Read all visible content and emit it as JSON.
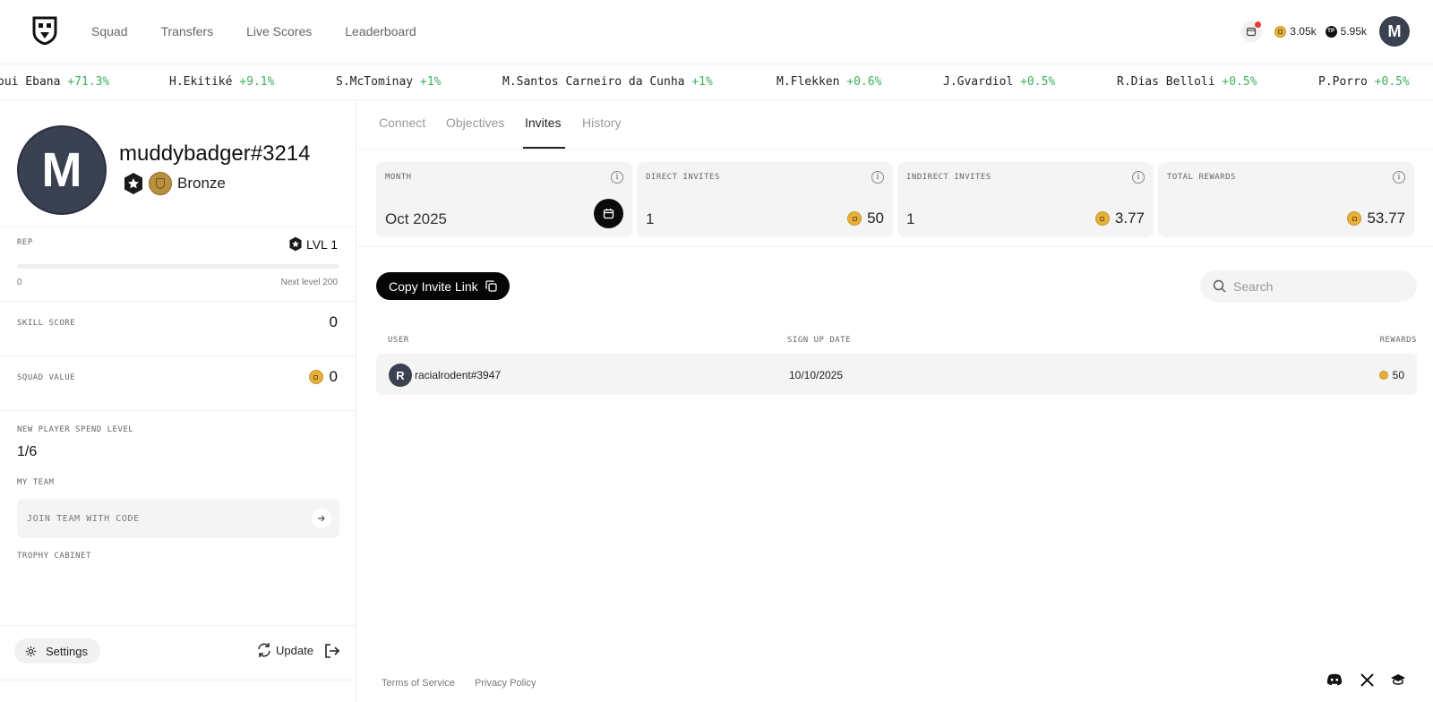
{
  "nav": [
    "Squad",
    "Transfers",
    "Live Scores",
    "Leaderboard"
  ],
  "header": {
    "coins": "3.05k",
    "points_badge": "TP",
    "points": "5.95k",
    "avatar_initial": "M"
  },
  "ticker": [
    {
      "name": "oui Ebana",
      "change": "+71.3%"
    },
    {
      "name": "H.Ekitiké",
      "change": "+9.1%"
    },
    {
      "name": "S.McTominay",
      "change": "+1%"
    },
    {
      "name": "M.Santos Carneiro da Cunha",
      "change": "+1%"
    },
    {
      "name": "M.Flekken",
      "change": "+0.6%"
    },
    {
      "name": "J.Gvardiol",
      "change": "+0.5%"
    },
    {
      "name": "R.Dias Belloli",
      "change": "+0.5%"
    },
    {
      "name": "P.Porro",
      "change": "+0.5%"
    }
  ],
  "profile": {
    "avatar_initial": "M",
    "username": "muddybadger#3214",
    "rank": "Bronze",
    "rep_label": "REP",
    "level": "LVL 1",
    "rep_progress": 0,
    "rep_min": "0",
    "rep_next": "Next level 200",
    "skill_label": "SKILL SCORE",
    "skill_value": "0",
    "squad_label": "SQUAD VALUE",
    "squad_value": "0",
    "spend_label": "NEW PLAYER SPEND LEVEL",
    "spend_value": "1/6",
    "team_label": "MY TEAM",
    "team_placeholder": "JOIN TEAM WITH CODE",
    "trophy_label": "TROPHY CABINET",
    "settings": "Settings",
    "update": "Update"
  },
  "tabs": [
    "Connect",
    "Objectives",
    "Invites",
    "History"
  ],
  "active_tab": "Invites",
  "cards": {
    "month": {
      "label": "MONTH",
      "value": "Oct 2025"
    },
    "direct": {
      "label": "DIRECT INVITES",
      "value": "1",
      "reward": "50"
    },
    "indirect": {
      "label": "INDIRECT INVITES",
      "value": "1",
      "reward": "3.77"
    },
    "total": {
      "label": "TOTAL REWARDS",
      "reward": "53.77"
    }
  },
  "actions": {
    "copy_invite": "Copy Invite Link",
    "search_placeholder": "Search"
  },
  "table": {
    "headers": [
      "USER",
      "SIGN UP DATE",
      "REWARDS"
    ],
    "rows": [
      {
        "initial": "R",
        "user": "racialrodent#3947",
        "date": "10/10/2025",
        "reward": "50"
      }
    ]
  },
  "footer": {
    "terms": "Terms of Service",
    "privacy": "Privacy Policy"
  },
  "colors": {
    "accent": "#111111",
    "positive": "#3cb05a",
    "coin": "#e5b13a",
    "notification": "#e53935"
  }
}
